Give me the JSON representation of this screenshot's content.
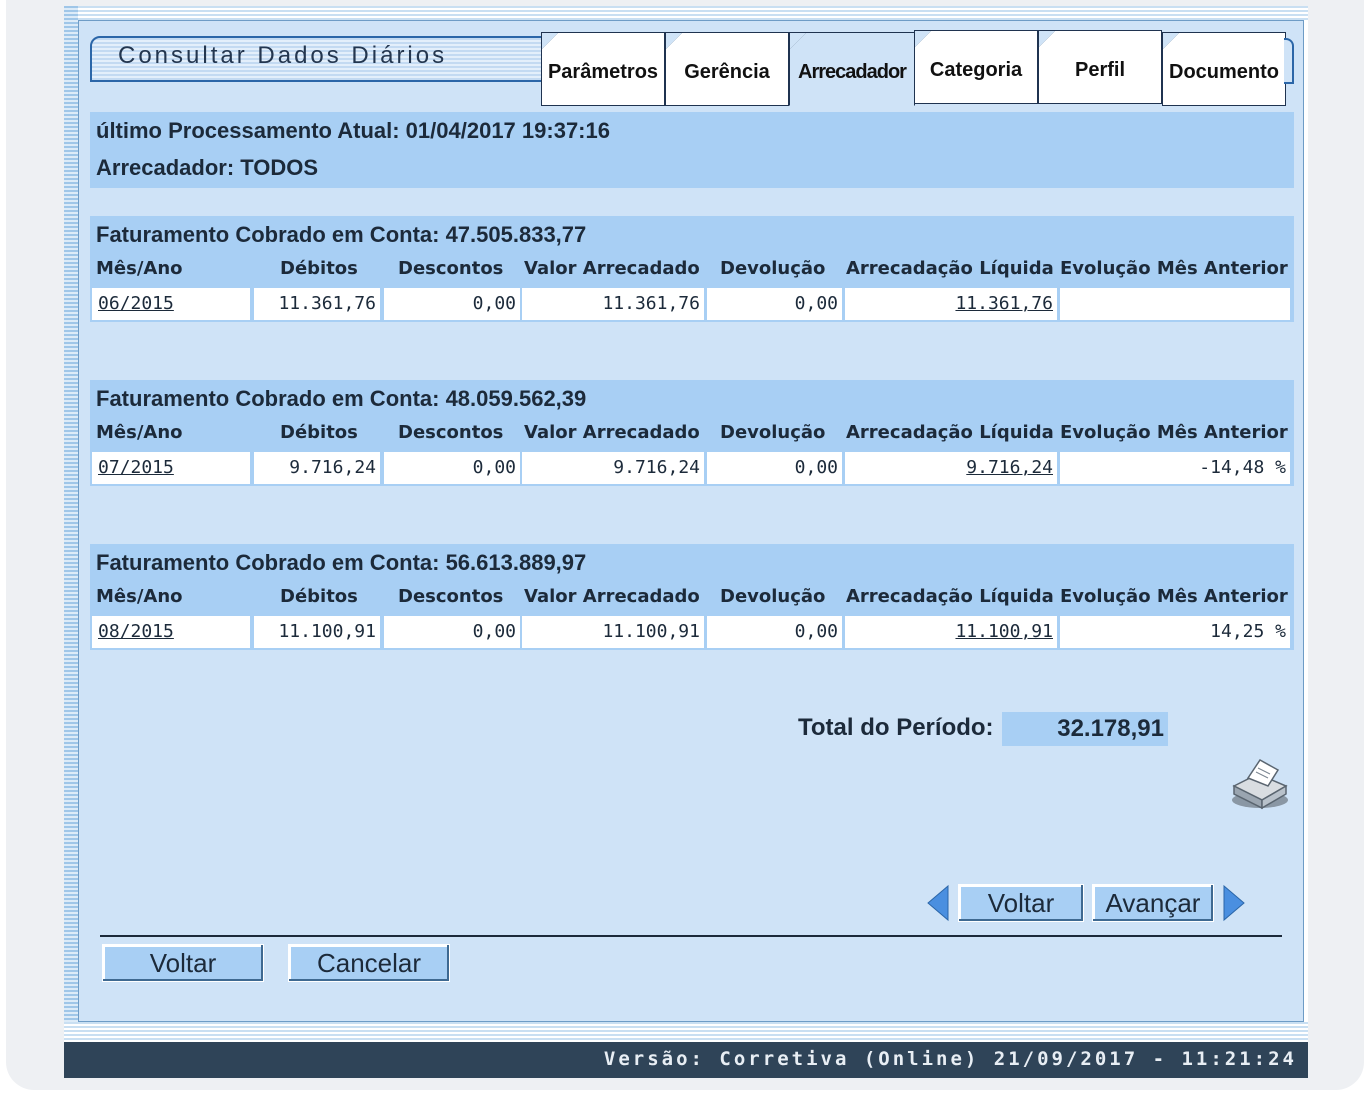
{
  "window": {
    "title": "Consultar Dados Diários"
  },
  "tabs": [
    {
      "label": "Parâmetros",
      "active": false
    },
    {
      "label": "Gerência",
      "active": false
    },
    {
      "label": "Arrecadador",
      "active": true
    },
    {
      "label": "Categoria",
      "active": false
    },
    {
      "label": "Perfil",
      "active": false
    },
    {
      "label": "Documento",
      "active": false
    }
  ],
  "info": {
    "processamento": "último Processamento Atual: 01/04/2017 19:37:16",
    "arrecadador": "Arrecadador: TODOS"
  },
  "columns": [
    "Mês/Ano",
    "Débitos",
    "Descontos",
    "Valor Arrecadado",
    "Devolução",
    "Arrecadação Líquida",
    "Evolução Mês Anterior"
  ],
  "sections": [
    {
      "title": "Faturamento Cobrado em Conta: 47.505.833,77",
      "row": {
        "mes_ano": "06/2015",
        "debitos": "11.361,76",
        "descontos": "0,00",
        "valor_arrecadado": "11.361,76",
        "devolucao": "0,00",
        "arrecadacao_liquida": "11.361,76",
        "evolucao": ""
      }
    },
    {
      "title": "Faturamento Cobrado em Conta: 48.059.562,39",
      "row": {
        "mes_ano": "07/2015",
        "debitos": "9.716,24",
        "descontos": "0,00",
        "valor_arrecadado": "9.716,24",
        "devolucao": "0,00",
        "arrecadacao_liquida": "9.716,24",
        "evolucao": "-14,48 %"
      }
    },
    {
      "title": "Faturamento Cobrado em Conta: 56.613.889,97",
      "row": {
        "mes_ano": "08/2015",
        "debitos": "11.100,91",
        "descontos": "0,00",
        "valor_arrecadado": "11.100,91",
        "devolucao": "0,00",
        "arrecadacao_liquida": "11.100,91",
        "evolucao": "14,25 %"
      }
    }
  ],
  "total": {
    "label": "Total do Período:",
    "value": "32.178,91"
  },
  "icons": {
    "print": "printer-icon",
    "prev": "arrow-left-icon",
    "next": "arrow-right-icon"
  },
  "nav_buttons": {
    "voltar": "Voltar",
    "avancar": "Avançar"
  },
  "form_buttons": {
    "voltar": "Voltar",
    "cancelar": "Cancelar"
  },
  "footer": {
    "version": "Versão: Corretiva (Online) 21/09/2017 - 11:21:24"
  },
  "colors": {
    "panel_bg": "#cfe3f7",
    "header_bg": "#a8cff4",
    "footer_bg": "#2f4458",
    "accent": "#2b66a8"
  }
}
